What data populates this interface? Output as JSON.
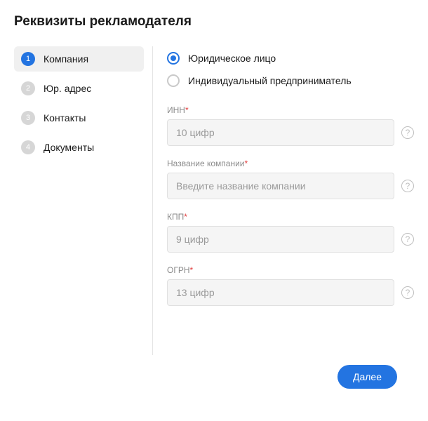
{
  "title": "Реквизиты рекламодателя",
  "steps": [
    {
      "num": "1",
      "label": "Компания",
      "active": true
    },
    {
      "num": "2",
      "label": "Юр. адрес",
      "active": false
    },
    {
      "num": "3",
      "label": "Контакты",
      "active": false
    },
    {
      "num": "4",
      "label": "Документы",
      "active": false
    }
  ],
  "entity_type": {
    "legal": {
      "label": "Юридическое лицо",
      "selected": true
    },
    "individual": {
      "label": "Индивидуальный предприниматель",
      "selected": false
    }
  },
  "fields": {
    "inn": {
      "label": "ИНН",
      "required": "*",
      "placeholder": "10 цифр",
      "value": ""
    },
    "company": {
      "label": "Название компании",
      "required": "*",
      "placeholder": "Введите название компании",
      "value": ""
    },
    "kpp": {
      "label": "КПП",
      "required": "*",
      "placeholder": "9 цифр",
      "value": ""
    },
    "ogrn": {
      "label": "ОГРН",
      "required": "*",
      "placeholder": "13 цифр",
      "value": ""
    }
  },
  "buttons": {
    "next": "Далее"
  },
  "help_glyph": "?"
}
